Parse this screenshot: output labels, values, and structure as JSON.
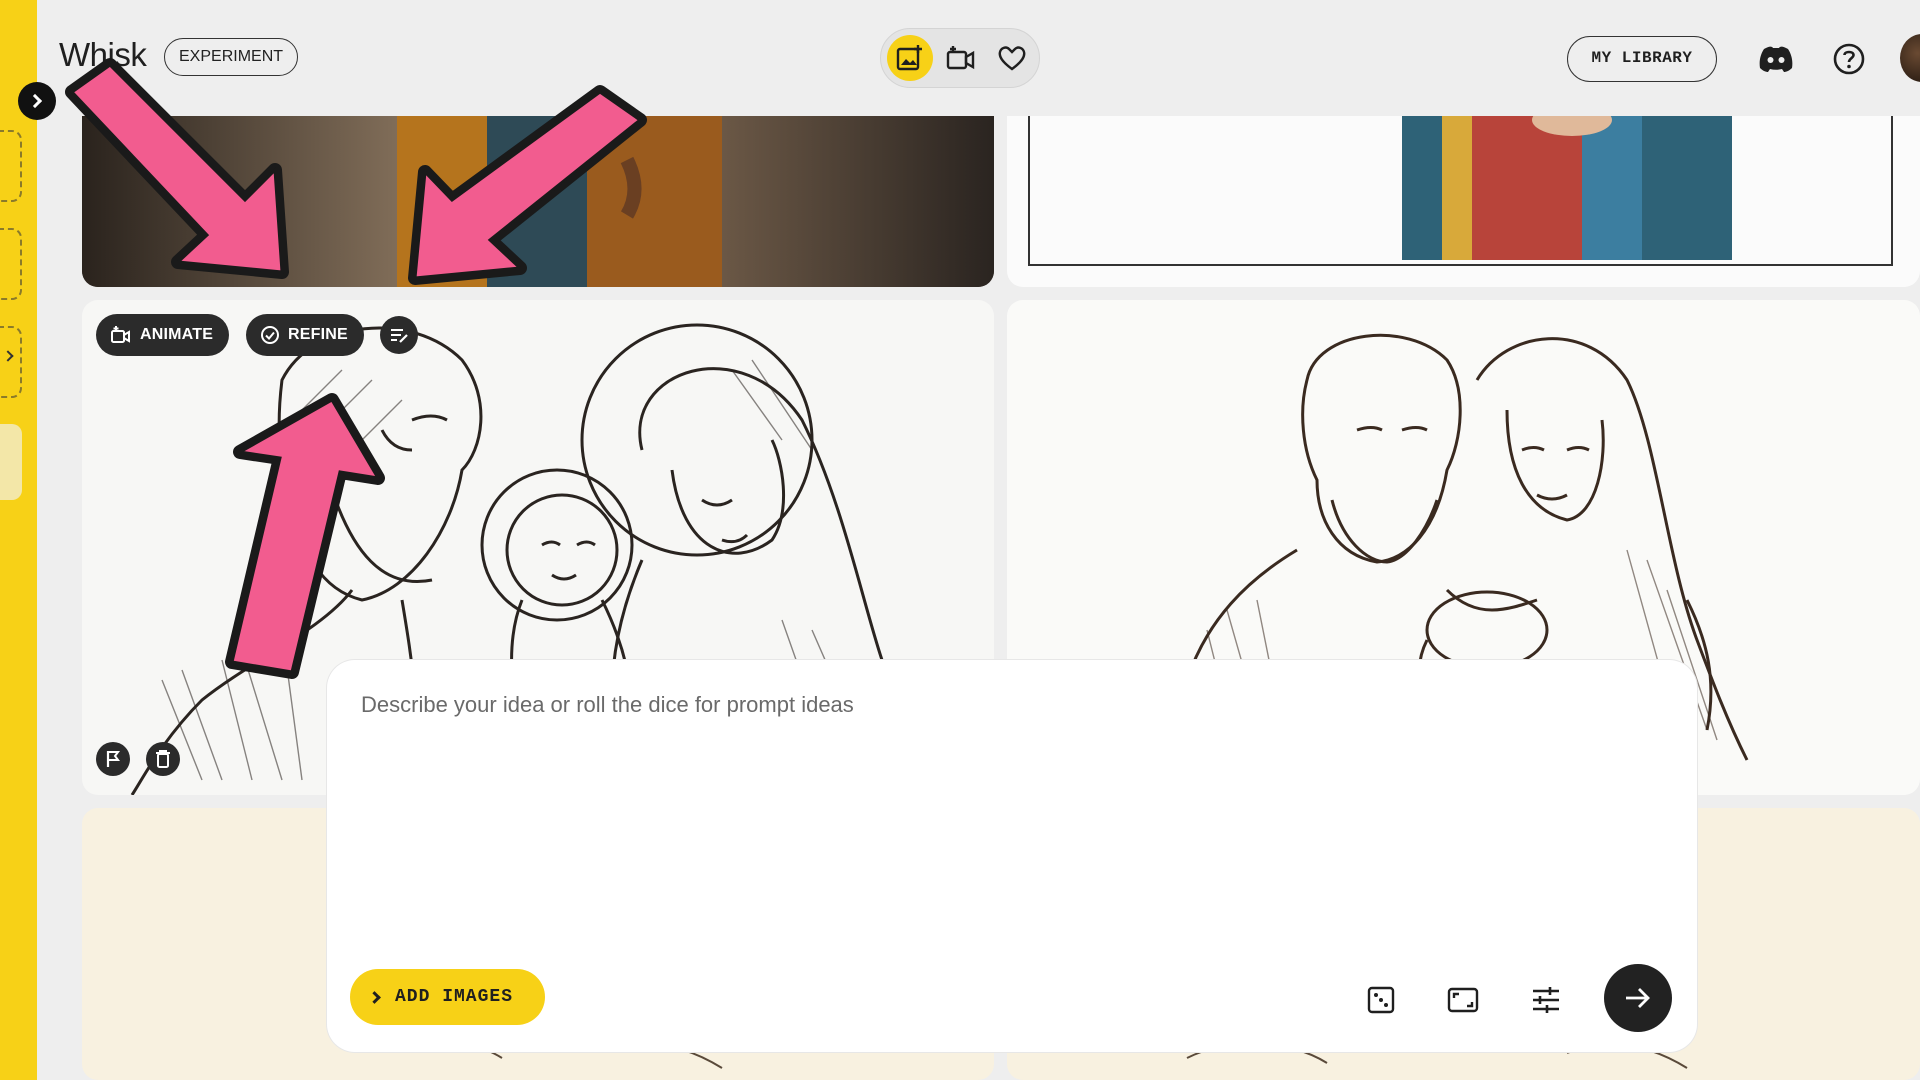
{
  "app": {
    "title": "Whisk",
    "badge": "EXPERIMENT"
  },
  "header": {
    "modes": [
      {
        "name": "image-mode",
        "icon": "add-photo-icon",
        "active": true
      },
      {
        "name": "video-mode",
        "icon": "video-camera-icon",
        "active": false
      },
      {
        "name": "favorites",
        "icon": "heart-icon",
        "active": false
      }
    ],
    "library_label": "MY LIBRARY",
    "icons": [
      "discord-icon",
      "help-icon",
      "avatar"
    ]
  },
  "card_actions": {
    "animate_label": "ANIMATE",
    "refine_label": "REFINE",
    "icons": [
      "animate-icon",
      "refine-icon",
      "edit-prompt-icon",
      "flag-icon",
      "delete-icon"
    ]
  },
  "prompt": {
    "placeholder": "Describe your idea or roll the dice for prompt ideas",
    "add_images_label": "ADD IMAGES",
    "tools": [
      "dice-icon",
      "aspect-ratio-icon",
      "settings-sliders-icon"
    ],
    "submit_icon": "arrow-right-icon"
  },
  "colors": {
    "accent_yellow": "#f7d117",
    "annotation_pink": "#f25c8f",
    "dark": "#222222"
  }
}
